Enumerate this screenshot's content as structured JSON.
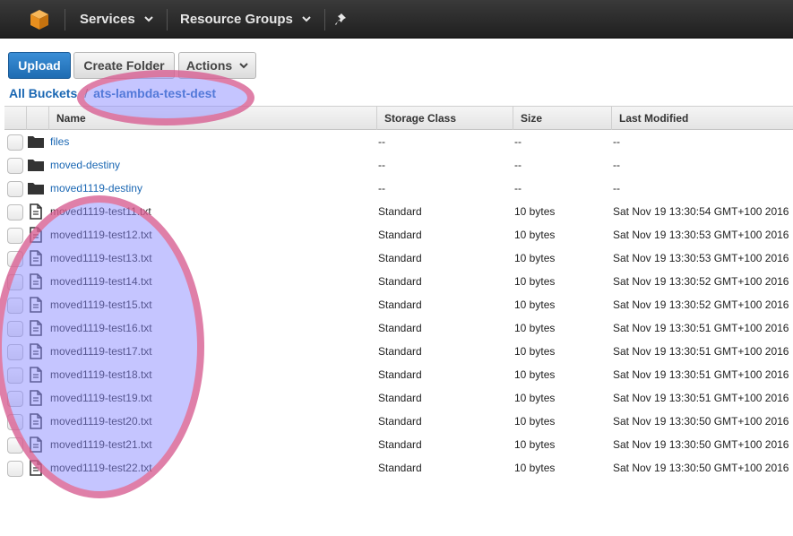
{
  "nav": {
    "logo_icon": "aws-cube-icon",
    "services_label": "Services",
    "resource_groups_label": "Resource Groups",
    "pin_icon": "pin-icon"
  },
  "toolbar": {
    "upload_label": "Upload",
    "create_folder_label": "Create Folder",
    "actions_label": "Actions"
  },
  "breadcrumb": {
    "root_label": "All Buckets",
    "separator": "/",
    "bucket_label": "ats-lambda-test-dest"
  },
  "table": {
    "headers": {
      "name": "Name",
      "storage_class": "Storage Class",
      "size": "Size",
      "last_modified": "Last Modified"
    },
    "rows": [
      {
        "type": "folder",
        "name": "files",
        "storage_class": "--",
        "size": "--",
        "last_modified": "--"
      },
      {
        "type": "folder",
        "name": "moved-destiny",
        "storage_class": "--",
        "size": "--",
        "last_modified": "--"
      },
      {
        "type": "folder",
        "name": "moved1119-destiny",
        "storage_class": "--",
        "size": "--",
        "last_modified": "--"
      },
      {
        "type": "file",
        "name": "moved1119-test11.txt",
        "storage_class": "Standard",
        "size": "10 bytes",
        "last_modified": "Sat Nov 19 13:30:54 GMT+100 2016"
      },
      {
        "type": "file",
        "name": "moved1119-test12.txt",
        "storage_class": "Standard",
        "size": "10 bytes",
        "last_modified": "Sat Nov 19 13:30:53 GMT+100 2016"
      },
      {
        "type": "file",
        "name": "moved1119-test13.txt",
        "storage_class": "Standard",
        "size": "10 bytes",
        "last_modified": "Sat Nov 19 13:30:53 GMT+100 2016"
      },
      {
        "type": "file",
        "name": "moved1119-test14.txt",
        "storage_class": "Standard",
        "size": "10 bytes",
        "last_modified": "Sat Nov 19 13:30:52 GMT+100 2016"
      },
      {
        "type": "file",
        "name": "moved1119-test15.txt",
        "storage_class": "Standard",
        "size": "10 bytes",
        "last_modified": "Sat Nov 19 13:30:52 GMT+100 2016"
      },
      {
        "type": "file",
        "name": "moved1119-test16.txt",
        "storage_class": "Standard",
        "size": "10 bytes",
        "last_modified": "Sat Nov 19 13:30:51 GMT+100 2016"
      },
      {
        "type": "file",
        "name": "moved1119-test17.txt",
        "storage_class": "Standard",
        "size": "10 bytes",
        "last_modified": "Sat Nov 19 13:30:51 GMT+100 2016"
      },
      {
        "type": "file",
        "name": "moved1119-test18.txt",
        "storage_class": "Standard",
        "size": "10 bytes",
        "last_modified": "Sat Nov 19 13:30:51 GMT+100 2016"
      },
      {
        "type": "file",
        "name": "moved1119-test19.txt",
        "storage_class": "Standard",
        "size": "10 bytes",
        "last_modified": "Sat Nov 19 13:30:51 GMT+100 2016"
      },
      {
        "type": "file",
        "name": "moved1119-test20.txt",
        "storage_class": "Standard",
        "size": "10 bytes",
        "last_modified": "Sat Nov 19 13:30:50 GMT+100 2016"
      },
      {
        "type": "file",
        "name": "moved1119-test21.txt",
        "storage_class": "Standard",
        "size": "10 bytes",
        "last_modified": "Sat Nov 19 13:30:50 GMT+100 2016"
      },
      {
        "type": "file",
        "name": "moved1119-test22.txt",
        "storage_class": "Standard",
        "size": "10 bytes",
        "last_modified": "Sat Nov 19 13:30:50 GMT+100 2016"
      }
    ]
  },
  "colors": {
    "topbar": "#2b2b2b",
    "link": "#1a67b3",
    "upload_button": "#2a7cc7",
    "highlight_fill": "#8c8cff",
    "highlight_border": "#f0506e"
  }
}
